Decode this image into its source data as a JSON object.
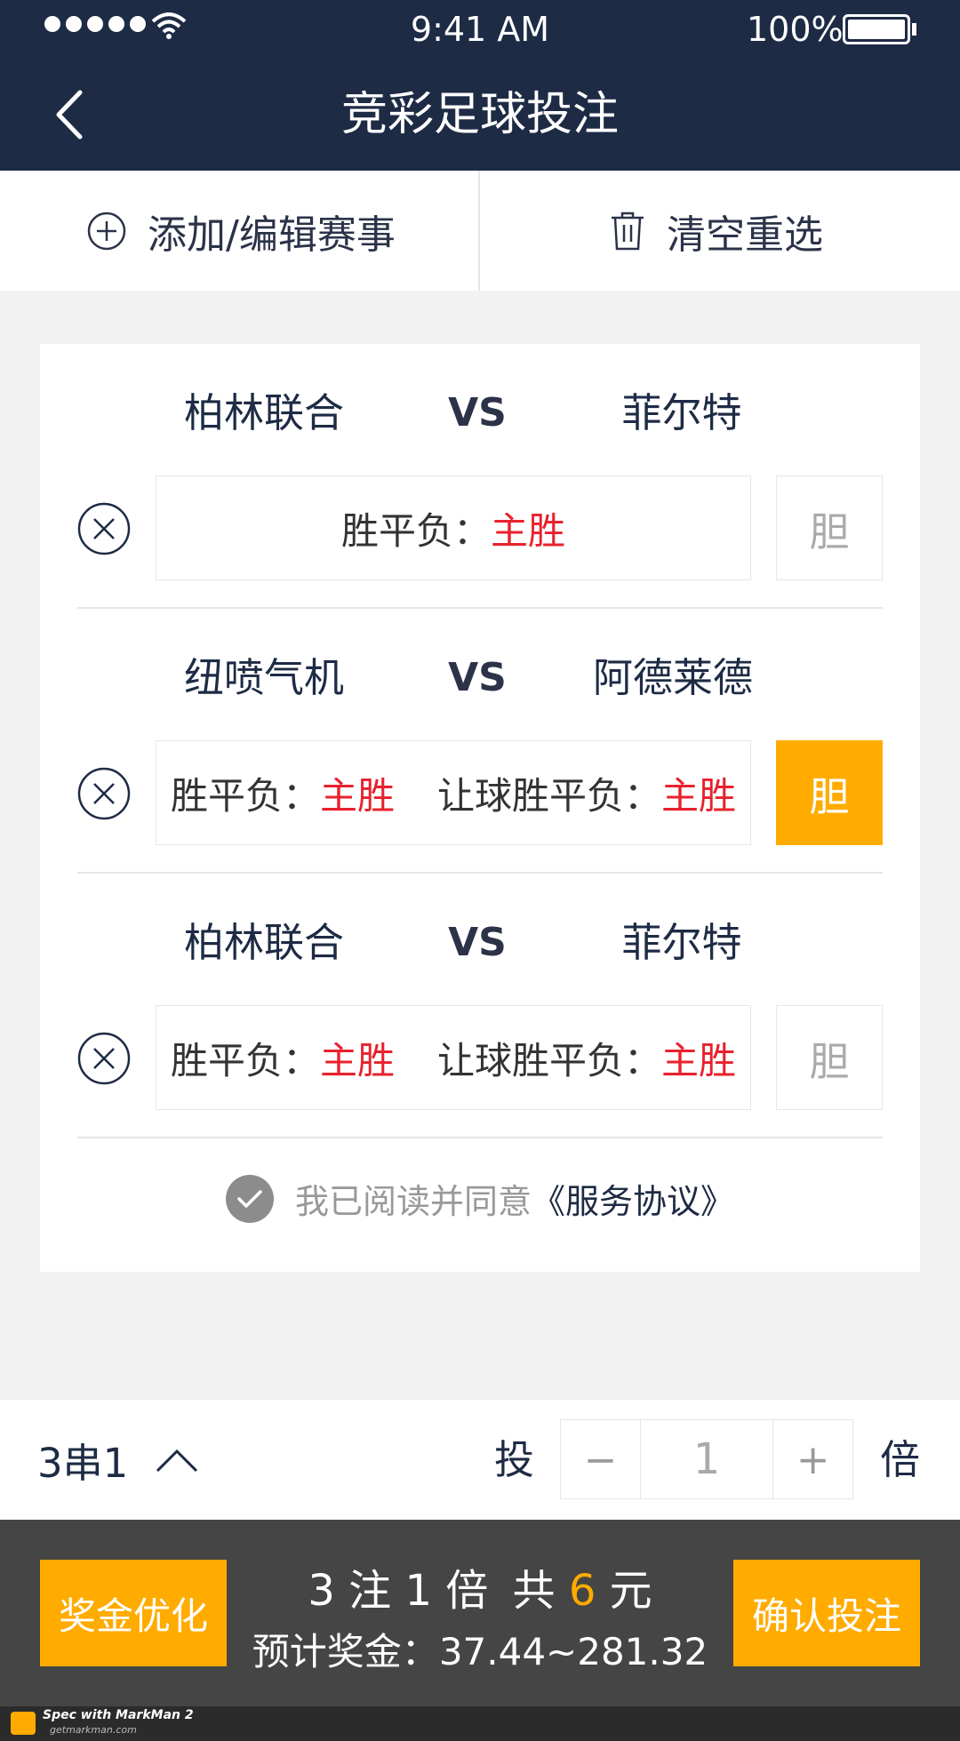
{
  "status": {
    "time": "9:41 AM",
    "battery": "100%"
  },
  "nav": {
    "title": "竞彩足球投注"
  },
  "toolbar": {
    "add_label": "添加/编辑赛事",
    "clear_label": "清空重选"
  },
  "matches": [
    {
      "home": "柏林联合",
      "vs": "VS",
      "away": "菲尔特",
      "bets": [
        {
          "label": "胜平负：",
          "value": "主胜"
        }
      ],
      "banker": "胆",
      "banker_active": false
    },
    {
      "home": "纽喷气机",
      "vs": "VS",
      "away": "阿德莱德",
      "bets": [
        {
          "label": "胜平负：",
          "value": "主胜"
        },
        {
          "label": "让球胜平负：",
          "value": "主胜"
        }
      ],
      "banker": "胆",
      "banker_active": true
    },
    {
      "home": "柏林联合",
      "vs": "VS",
      "away": "菲尔特",
      "bets": [
        {
          "label": "胜平负：",
          "value": "主胜"
        },
        {
          "label": "让球胜平负：",
          "value": "主胜"
        }
      ],
      "banker": "胆",
      "banker_active": false
    }
  ],
  "agreement": {
    "text": "我已阅读并同意",
    "link": "《服务协议》"
  },
  "multiplier": {
    "combo": "3串1",
    "label_before": "投",
    "minus": "−",
    "value": "1",
    "plus": "+",
    "label_after": "倍"
  },
  "footer": {
    "optimize_label": "奖金优化",
    "bets_count": "3",
    "bets_unit": "注",
    "times_count": "1",
    "times_unit": "倍",
    "total_prefix": "共",
    "total_amount": "6",
    "total_unit": "元",
    "prize_label": "预计奖金：",
    "prize_range": "37.44~281.32",
    "confirm_label": "确认投注"
  },
  "spec": {
    "brand": "Spec with MarkMan 2",
    "site": "getmarkman.com"
  },
  "colors": {
    "navy": "#1e2b45",
    "orange": "#ffab00",
    "red": "#e8212d"
  }
}
